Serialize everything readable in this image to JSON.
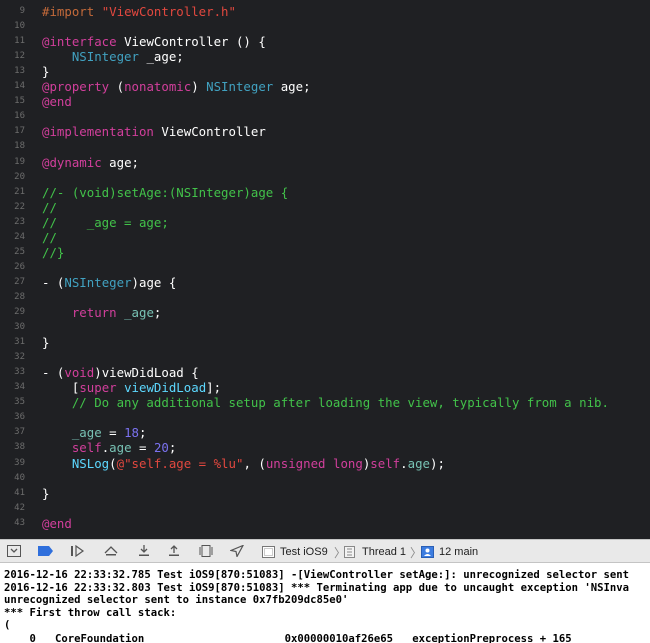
{
  "editor": {
    "lines": [
      {
        "num": "9",
        "segments": [
          {
            "t": "#import ",
            "c": "mac"
          },
          {
            "t": "\"ViewController.h\"",
            "c": "str"
          }
        ]
      },
      {
        "num": "10",
        "segments": []
      },
      {
        "num": "11",
        "segments": [
          {
            "t": "@interface ",
            "c": "kw"
          },
          {
            "t": "ViewController",
            "c": "def"
          },
          {
            "t": " () {",
            "c": "def"
          }
        ]
      },
      {
        "num": "12",
        "segments": [
          {
            "t": "    ",
            "c": "def"
          },
          {
            "t": "NSInteger",
            "c": "typ"
          },
          {
            "t": " _age;",
            "c": "def"
          }
        ]
      },
      {
        "num": "13",
        "segments": [
          {
            "t": "}",
            "c": "def"
          }
        ]
      },
      {
        "num": "14",
        "segments": [
          {
            "t": "@property",
            "c": "kw"
          },
          {
            "t": " (",
            "c": "def"
          },
          {
            "t": "nonatomic",
            "c": "kw"
          },
          {
            "t": ") ",
            "c": "def"
          },
          {
            "t": "NSInteger",
            "c": "typ"
          },
          {
            "t": " age;",
            "c": "def"
          }
        ]
      },
      {
        "num": "15",
        "segments": [
          {
            "t": "@end",
            "c": "kw"
          }
        ]
      },
      {
        "num": "16",
        "segments": []
      },
      {
        "num": "17",
        "segments": [
          {
            "t": "@implementation",
            "c": "kw"
          },
          {
            "t": " ViewController",
            "c": "def"
          }
        ]
      },
      {
        "num": "18",
        "segments": []
      },
      {
        "num": "19",
        "segments": [
          {
            "t": "@dynamic",
            "c": "kw"
          },
          {
            "t": " age;",
            "c": "def"
          }
        ]
      },
      {
        "num": "20",
        "segments": []
      },
      {
        "num": "21",
        "segments": [
          {
            "t": "//- (void)setAge:(NSInteger)age {",
            "c": "cmt"
          }
        ]
      },
      {
        "num": "22",
        "segments": [
          {
            "t": "//",
            "c": "cmt"
          }
        ]
      },
      {
        "num": "23",
        "segments": [
          {
            "t": "//    _age = age;",
            "c": "cmt"
          }
        ]
      },
      {
        "num": "24",
        "segments": [
          {
            "t": "//",
            "c": "cmt"
          }
        ]
      },
      {
        "num": "25",
        "segments": [
          {
            "t": "//}",
            "c": "cmt"
          }
        ]
      },
      {
        "num": "26",
        "segments": []
      },
      {
        "num": "27",
        "segments": [
          {
            "t": "- (",
            "c": "def"
          },
          {
            "t": "NSInteger",
            "c": "typ"
          },
          {
            "t": ")age {",
            "c": "def"
          }
        ]
      },
      {
        "num": "28",
        "segments": []
      },
      {
        "num": "29",
        "segments": [
          {
            "t": "    ",
            "c": "def"
          },
          {
            "t": "return",
            "c": "kw"
          },
          {
            "t": " ",
            "c": "def"
          },
          {
            "t": "_age",
            "c": "prop"
          },
          {
            "t": ";",
            "c": "def"
          }
        ]
      },
      {
        "num": "30",
        "segments": []
      },
      {
        "num": "31",
        "segments": [
          {
            "t": "}",
            "c": "def"
          }
        ]
      },
      {
        "num": "32",
        "segments": []
      },
      {
        "num": "33",
        "segments": [
          {
            "t": "- (",
            "c": "def"
          },
          {
            "t": "void",
            "c": "kw"
          },
          {
            "t": ")viewDidLoad {",
            "c": "def"
          }
        ]
      },
      {
        "num": "34",
        "segments": [
          {
            "t": "    [",
            "c": "def"
          },
          {
            "t": "super",
            "c": "kw"
          },
          {
            "t": " ",
            "c": "def"
          },
          {
            "t": "viewDidLoad",
            "c": "cls"
          },
          {
            "t": "];",
            "c": "def"
          }
        ]
      },
      {
        "num": "35",
        "segments": [
          {
            "t": "    // Do any additional setup after loading the view, typically from a nib.",
            "c": "cmt"
          }
        ]
      },
      {
        "num": "36",
        "segments": []
      },
      {
        "num": "37",
        "segments": [
          {
            "t": "    ",
            "c": "def"
          },
          {
            "t": "_age",
            "c": "prop"
          },
          {
            "t": " = ",
            "c": "def"
          },
          {
            "t": "18",
            "c": "num"
          },
          {
            "t": ";",
            "c": "def"
          }
        ]
      },
      {
        "num": "38",
        "segments": [
          {
            "t": "    ",
            "c": "def"
          },
          {
            "t": "self",
            "c": "kw"
          },
          {
            "t": ".",
            "c": "def"
          },
          {
            "t": "age",
            "c": "prop"
          },
          {
            "t": " = ",
            "c": "def"
          },
          {
            "t": "20",
            "c": "num"
          },
          {
            "t": ";",
            "c": "def"
          }
        ]
      },
      {
        "num": "39",
        "segments": [
          {
            "t": "    ",
            "c": "def"
          },
          {
            "t": "NSLog",
            "c": "cls"
          },
          {
            "t": "(",
            "c": "def"
          },
          {
            "t": "@\"self.age = %lu\"",
            "c": "str"
          },
          {
            "t": ", (",
            "c": "def"
          },
          {
            "t": "unsigned long",
            "c": "kw"
          },
          {
            "t": ")",
            "c": "def"
          },
          {
            "t": "self",
            "c": "kw"
          },
          {
            "t": ".",
            "c": "def"
          },
          {
            "t": "age",
            "c": "prop"
          },
          {
            "t": ");",
            "c": "def"
          }
        ]
      },
      {
        "num": "40",
        "segments": []
      },
      {
        "num": "41",
        "segments": [
          {
            "t": "}",
            "c": "def"
          }
        ]
      },
      {
        "num": "42",
        "segments": []
      },
      {
        "num": "43",
        "segments": [
          {
            "t": "@end",
            "c": "kw"
          }
        ]
      }
    ]
  },
  "debugbar": {
    "target": "Test iOS9",
    "thread": "Thread 1",
    "frame": "12 main"
  },
  "console": {
    "lines": [
      "2016-12-16 22:33:32.785 Test iOS9[870:51083] -[ViewController setAge:]: unrecognized selector sent",
      "2016-12-16 22:33:32.803 Test iOS9[870:51083] *** Terminating app due to uncaught exception 'NSInva",
      "unrecognized selector sent to instance 0x7fb209dc85e0'",
      "*** First throw call stack:",
      "(",
      "    0   CoreFoundation                      0x00000010af26e65   exceptionPreprocess + 165"
    ]
  }
}
